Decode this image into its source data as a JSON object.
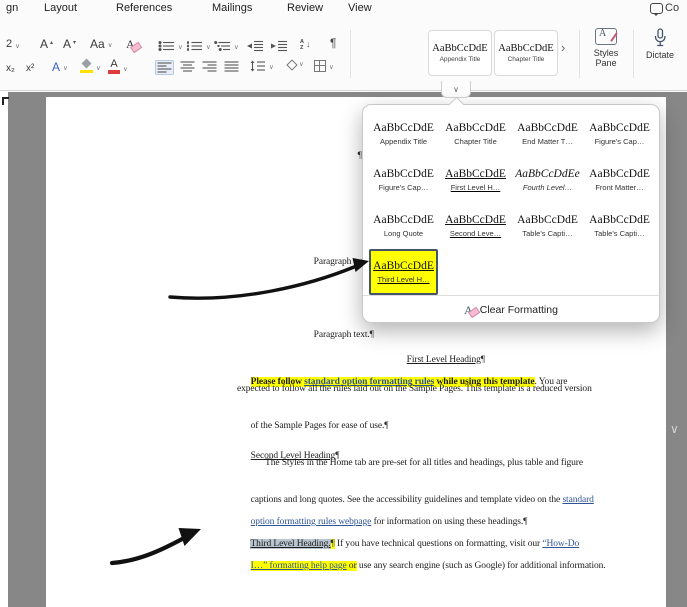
{
  "icons": {
    "chevron": "∨",
    "up_caret": "▴",
    "down_caret": "▾",
    "down_arrow": "↓",
    "more_arrow": "›"
  },
  "colors": {
    "highlight": "#ffff00",
    "link": "#2f5496",
    "selection": "#b9c5d1",
    "highlighter_bar": "#ffe100",
    "font_color_bar": "#e03b3b"
  },
  "ribbon": {
    "tabs": [
      {
        "label": "gn"
      },
      {
        "label": "Layout"
      },
      {
        "label": "References"
      },
      {
        "label": "Mailings"
      },
      {
        "label": "Review"
      },
      {
        "label": "View"
      }
    ],
    "comments": {
      "label": "Co"
    },
    "font": {
      "size_value": "2",
      "grow_label": "A",
      "shrink_label": "A",
      "change_case_label": "Aa",
      "clear_format_label": "A",
      "subscript_label": "x₂",
      "superscript_label": "x²",
      "text_effects_label": "A",
      "font_color_label": "A"
    },
    "paragraph": {
      "pilcrow_label": "¶",
      "sort_top": "A",
      "sort_bottom": "Z"
    },
    "gallery": {
      "items": [
        {
          "preview": "AaBbCcDdE",
          "label": "Appendix Title"
        },
        {
          "preview": "AaBbCcDdE",
          "label": "Chapter Title"
        }
      ],
      "more_label": "›",
      "expand_label": "∨"
    },
    "styles_pane": {
      "line1": "Styles",
      "line2": "Pane"
    },
    "dictate": {
      "label": "Dictate"
    }
  },
  "panel": {
    "items": [
      {
        "preview": "AaBbCcDdE",
        "label": "Appendix Title"
      },
      {
        "preview": "AaBbCcDdE",
        "label": "Chapter Title"
      },
      {
        "preview": "AaBbCcDdE",
        "label": "End Matter T…"
      },
      {
        "preview": "AaBbCcDdE",
        "label": "Figure's Cap…"
      },
      {
        "preview": "AaBbCcDdE",
        "label": "Figure's Cap…"
      },
      {
        "preview": "AaBbCcDdE",
        "label": "First Level H…"
      },
      {
        "preview": "AaBbCcDdEe",
        "label": "Fourth Level…"
      },
      {
        "preview": "AaBbCcDdE",
        "label": "Front Matter…"
      },
      {
        "preview": "AaBbCcDdE",
        "label": "Long Quote"
      },
      {
        "preview": "AaBbCcDdE",
        "label": "Second Leve…"
      },
      {
        "preview": "AaBbCcDdE",
        "label": "Table's Capti…"
      },
      {
        "preview": "AaBbCcDdE",
        "label": "Table's Capti…"
      },
      {
        "preview": "AaBbCcDdE",
        "label": "Third Level H…"
      }
    ],
    "clear": {
      "icon_label": "A",
      "label": "Clear Formatting"
    }
  },
  "doc": {
    "para_mark": "¶",
    "ptext1": {
      "text": "Paragraph text.",
      "mark": "¶"
    },
    "ptext2": {
      "text": "Paragraph text.",
      "mark": "¶"
    },
    "h1": {
      "text": "First Level Heading",
      "mark": "¶"
    },
    "p1l1": {
      "s1": "Please follow ",
      "s2": "standard option formatting rules",
      "s3": " while using this template",
      "s4": ". You are"
    },
    "p1l2": "expected to follow all the rules laid out on the Sample Pages. This template is a reduced version",
    "p1l3": {
      "text": "of the Sample Pages for ease of use.",
      "mark": "¶"
    },
    "h2": {
      "text": "Second Level Heading",
      "mark": "¶"
    },
    "p2l1": "The Styles in the Home tab are pre-set for all titles and headings, plus table and figure",
    "p2l2": {
      "s1": "captions and long quotes. See the accessibility guidelines and template video on the ",
      "s2": "standard"
    },
    "p2l3": {
      "s1": "option formatting rules webpage",
      "s2": " for information on using these headings.",
      "mark": "¶"
    },
    "p3l1": {
      "s1": "Third Level Heading.",
      "mark": "¶",
      "s2": " If you have technical questions on formatting, visit our ",
      "s3": "“How-Do"
    },
    "p3l2": {
      "s1": "I…” formatting help page",
      "s2": " or",
      "s3": " use any search engine (such as Google) for additional information."
    }
  }
}
